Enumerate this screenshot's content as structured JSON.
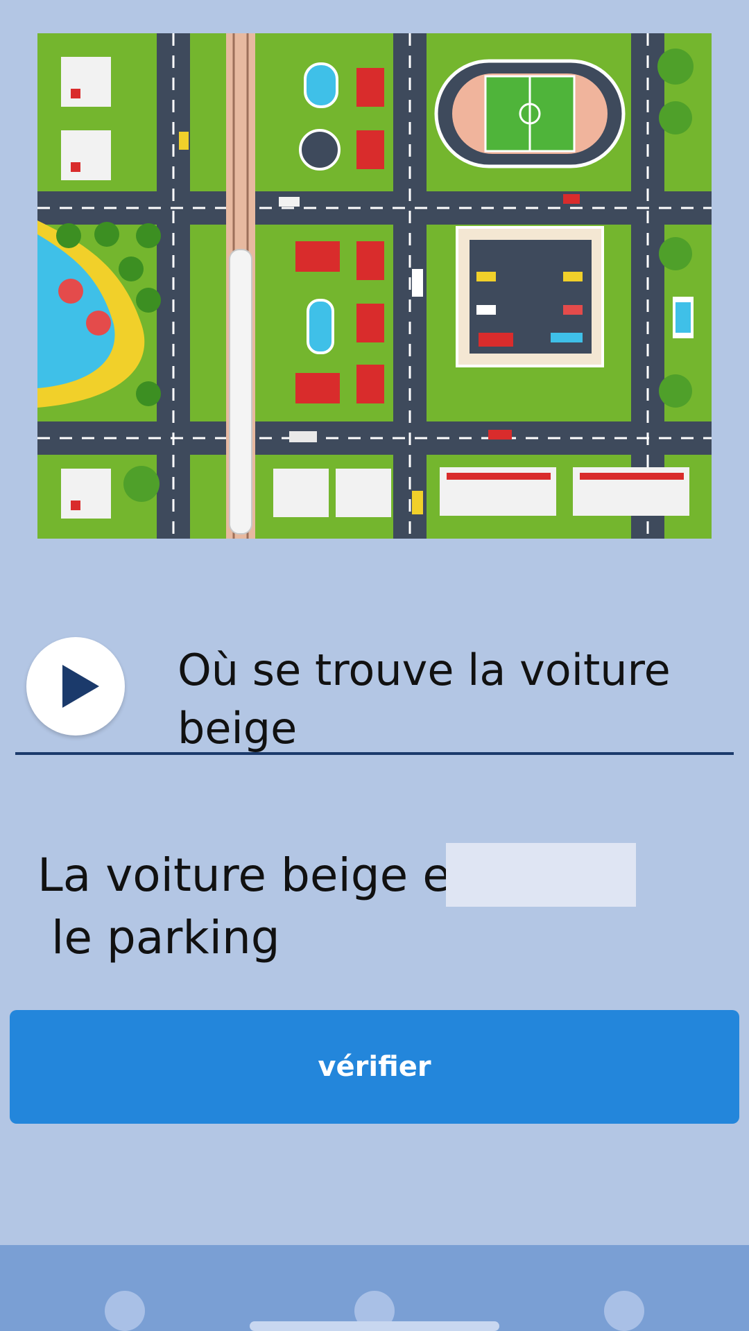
{
  "illustration": {
    "icon": "city-map-illustration",
    "colors": {
      "grass": "#74b62e",
      "road": "#3e4a5c",
      "roof": "#d92c2c",
      "water": "#3fc0e8",
      "sand": "#f1d02a"
    }
  },
  "audio": {
    "icon": "play-icon"
  },
  "question": {
    "text": "Où se trouve la voiture beige"
  },
  "sentence": {
    "before": "La voiture beige est",
    "answer_value": "",
    "after": " le parking"
  },
  "actions": {
    "verify_label": "vérifier"
  },
  "colors": {
    "background": "#b3c6e4",
    "accent": "#2386db",
    "nav": "#7a9fd4",
    "underline": "#1b3a6b"
  }
}
